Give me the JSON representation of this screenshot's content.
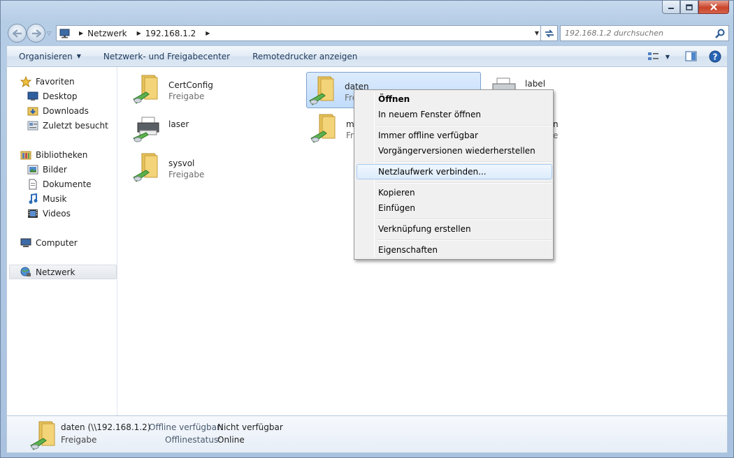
{
  "window": {
    "buttons": [
      "minimize",
      "maximize",
      "close"
    ]
  },
  "address": {
    "segments": [
      "Netzwerk",
      "192.168.1.2"
    ],
    "search_placeholder": "192.168.1.2 durchsuchen"
  },
  "toolbar": {
    "organize": "Organisieren",
    "network_center": "Netzwerk- und Freigabecenter",
    "remote_printers": "Remotedrucker anzeigen"
  },
  "sidebar": {
    "favorites": {
      "label": "Favoriten",
      "items": [
        "Desktop",
        "Downloads",
        "Zuletzt besucht"
      ]
    },
    "libraries": {
      "label": "Bibliotheken",
      "items": [
        "Bilder",
        "Dokumente",
        "Musik",
        "Videos"
      ]
    },
    "computer": "Computer",
    "network": "Netzwerk"
  },
  "items": [
    {
      "name": "CertConfig",
      "sub": "Freigabe",
      "icon": "share-folder-icon"
    },
    {
      "name": "daten",
      "sub": "Freigabe",
      "icon": "share-folder-icon",
      "selected": true
    },
    {
      "name": "label",
      "sub": "",
      "icon": "printer-icon"
    },
    {
      "name": "laser",
      "sub": "",
      "icon": "printer-icon"
    },
    {
      "name": "m",
      "sub": "Fr",
      "icon": "share-folder-icon"
    },
    {
      "name": "n",
      "sub": "e",
      "icon": "printer-icon"
    },
    {
      "name": "sysvol",
      "sub": "Freigabe",
      "icon": "share-folder-icon"
    }
  ],
  "context_menu": {
    "groups": [
      [
        "Öffnen",
        "In neuem Fenster öffnen"
      ],
      [
        "Immer offline verfügbar",
        "Vorgängerversionen wiederherstellen"
      ],
      [
        "Netzlaufwerk verbinden..."
      ],
      [
        "Kopieren",
        "Einfügen"
      ],
      [
        "Verknüpfung erstellen"
      ],
      [
        "Eigenschaften"
      ]
    ],
    "highlighted": "Netzlaufwerk verbinden..."
  },
  "details": {
    "name": "daten (\\\\192.168.1.2)",
    "type": "Freigabe",
    "offline_label": "Offline verfügbar:",
    "offline_value": "Nicht verfügbar",
    "status_label": "Offlinestatus:",
    "status_value": "Online"
  }
}
